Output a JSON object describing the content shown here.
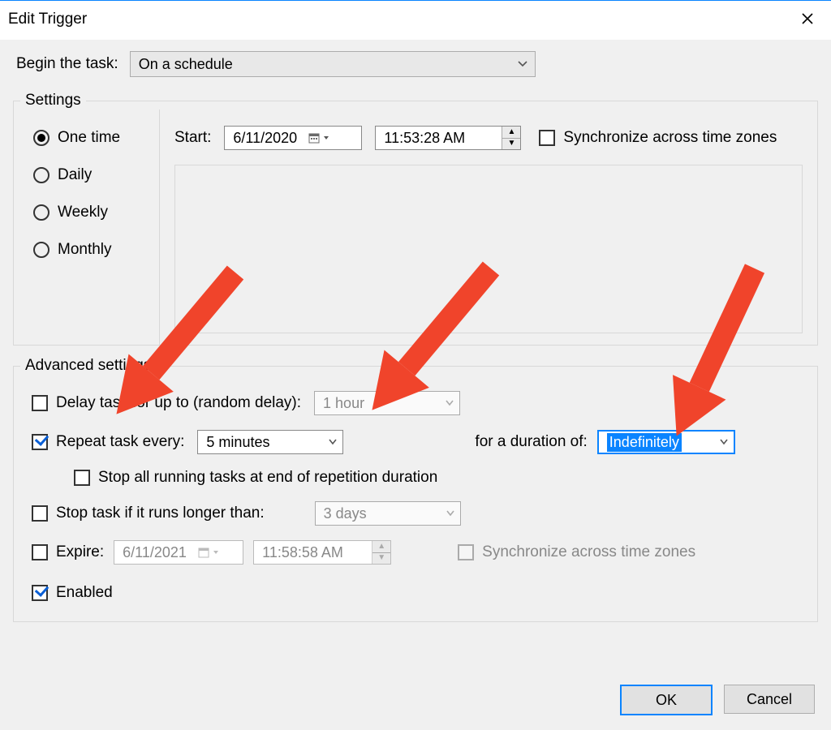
{
  "titlebar": {
    "title": "Edit Trigger"
  },
  "begin": {
    "label": "Begin the task:",
    "value": "On a schedule"
  },
  "settings": {
    "legend": "Settings",
    "freq": {
      "onetime": "One time",
      "daily": "Daily",
      "weekly": "Weekly",
      "monthly": "Monthly",
      "selected": "onetime"
    },
    "start_label": "Start:",
    "start_date": "6/11/2020",
    "start_time": "11:53:28 AM",
    "sync_tz_label": "Synchronize across time zones"
  },
  "advanced": {
    "legend": "Advanced settings",
    "delay_label": "Delay task for up to (random delay):",
    "delay_value": "1 hour",
    "repeat_label": "Repeat task every:",
    "repeat_value": "5 minutes",
    "duration_label": "for a duration of:",
    "duration_value": "Indefinitely",
    "stop_all_label": "Stop all running tasks at end of repetition duration",
    "stop_if_label": "Stop task if it runs longer than:",
    "stop_if_value": "3 days",
    "expire_label": "Expire:",
    "expire_date": "6/11/2021",
    "expire_time": "11:58:58 AM",
    "expire_sync_label": "Synchronize across time zones",
    "enabled_label": "Enabled"
  },
  "buttons": {
    "ok": "OK",
    "cancel": "Cancel"
  },
  "annotation": {
    "color": "#f0442b"
  }
}
